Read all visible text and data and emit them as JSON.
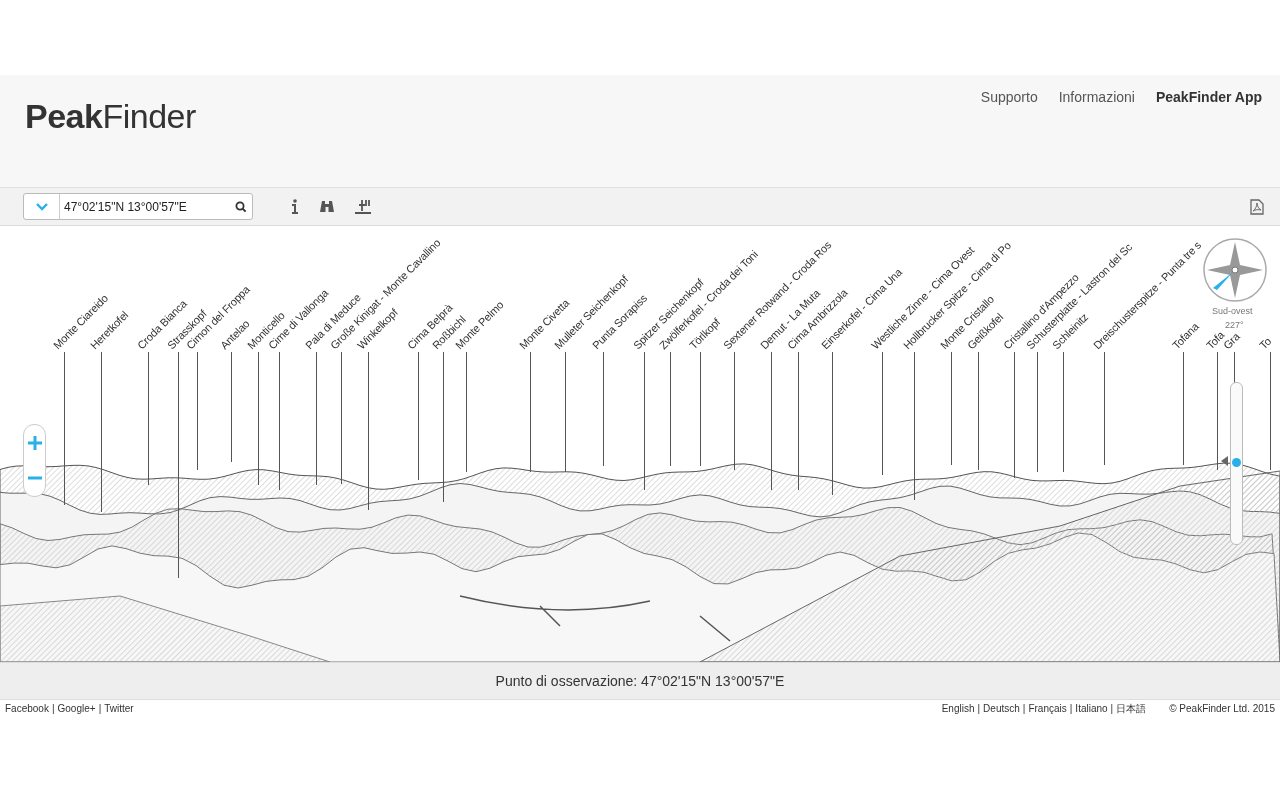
{
  "header": {
    "logo": "**Peak**Finder",
    "nav": [
      {
        "label": "Supporto",
        "selected": false
      },
      {
        "label": "Informazioni",
        "selected": false
      },
      {
        "label": "PeakFinder App",
        "selected": true
      }
    ]
  },
  "toolbar": {
    "location": "47°02'15\"N 13°00'57\"E"
  },
  "peaks": [
    {
      "name": "Monte Ciareido"
    },
    {
      "name": "Heretkofel"
    },
    {
      "name": "Croda Bianca"
    },
    {
      "name": "Strasskopf"
    },
    {
      "name": "Cimon del Froppa"
    },
    {
      "name": "Antelao"
    },
    {
      "name": "Monticello"
    },
    {
      "name": "Cime di Vallonga"
    },
    {
      "name": "Pala di Meduce"
    },
    {
      "name": "Große Kinigat - Monte Cavallino"
    },
    {
      "name": "Winkelkopf"
    },
    {
      "name": "Cima Belprà"
    },
    {
      "name": "Roßbichl"
    },
    {
      "name": "Monte Pelmo"
    },
    {
      "name": "Monte Civetta"
    },
    {
      "name": "Mulleter Seichenkopf"
    },
    {
      "name": "Punta Sorapiss"
    },
    {
      "name": "Spitzer Seichenkopf"
    },
    {
      "name": "Zwölferkofel - Croda dei Toni"
    },
    {
      "name": "Törlkopf"
    },
    {
      "name": "Sextener Rotwand - Croda Ros"
    },
    {
      "name": "Demut - La Muta"
    },
    {
      "name": "Cima Ambrizzola"
    },
    {
      "name": "Einserkofel - Cima Una"
    },
    {
      "name": "Westliche Zinne - Cima Ovest"
    },
    {
      "name": "Hollbrucker Spitze - Cima di Po"
    },
    {
      "name": "Monte Cristallo"
    },
    {
      "name": "Geißkofel"
    },
    {
      "name": "Cristallino d'Ampezzo"
    },
    {
      "name": "Schusterplatte - Lastron del Sc"
    },
    {
      "name": "Schleinitz"
    },
    {
      "name": "Dreischusterspitze - Punta tre s"
    },
    {
      "name": "Tofana"
    },
    {
      "name": "Tofa"
    },
    {
      "name": "Gra"
    },
    {
      "name": "To"
    }
  ],
  "compass": {
    "direction": "Sud-ovest",
    "degrees": "227°"
  },
  "zoom_slider": {
    "level": 0.49
  },
  "observation": "Punto di osservazione: 47°02'15\"N 13°00'57\"E",
  "footer": {
    "separator": "|",
    "social": [
      "Facebook",
      "Google+",
      "Twitter"
    ],
    "languages": [
      "English",
      "Deutsch",
      "Français",
      "Italiano",
      "日本語"
    ],
    "copyright": "© PeakFinder Ltd. 2015"
  }
}
